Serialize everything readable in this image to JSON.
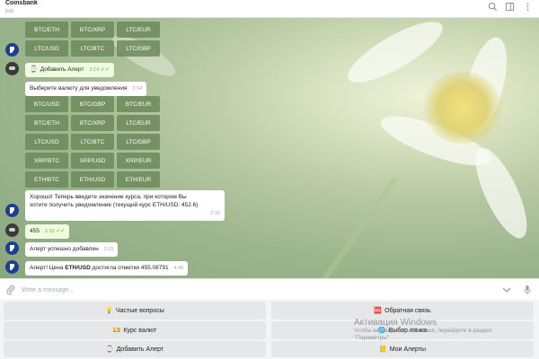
{
  "header": {
    "title": "Coinsbank",
    "subtitle": "bot"
  },
  "keyboard_top": [
    [
      "BTC/ETH",
      "BTC/XRP",
      "LTC/EUR"
    ],
    [
      "LTC/USD",
      "LTC/BTC",
      "LTC/GBP"
    ]
  ],
  "msg_add_alert": {
    "text": "Добавить Алерт",
    "time": "2:14"
  },
  "msg_choose": {
    "text": "Выберите валюту для уведомления",
    "time": "2:14"
  },
  "keyboard_main": [
    [
      "BTC/USD",
      "BTC/GBP",
      "BTC/EUR"
    ],
    [
      "BTC/ETH",
      "BTC/XRP",
      "LTC/EUR"
    ],
    [
      "LTC/USD",
      "LTC/BTC",
      "LTC/GBP"
    ],
    [
      "XRP/BTC",
      "XRP/USD",
      "XRP/EUR"
    ],
    [
      "ETH/BTC",
      "ETH/USD",
      "ETH/EUR"
    ]
  ],
  "msg_enter": {
    "line1": "Хорошо! Теперь введите значение курса, при котором Вы",
    "line2": "хотите получить уведомление (текущий курс ETH/USD: 452.6)",
    "time": "2:15"
  },
  "msg_value": {
    "text": "455",
    "time": "2:15"
  },
  "msg_added": {
    "text": "Алерт успешно добавлен",
    "time": "2:15"
  },
  "msg_triggered": {
    "prefix": "Алерт! Цена ",
    "pair": "ETH/USD",
    "suffix": " достигла отметки 455.08791",
    "time": "4:45"
  },
  "composer": {
    "placeholder": "Write a message..."
  },
  "reply_keyboard": {
    "faq": "Частые вопросы",
    "feedback": "Обратная связь",
    "rates": "Курс валют",
    "language": "Выбор языка",
    "add_alert": "Добавить Алерт",
    "my_alerts": "Мои Алерты"
  },
  "watermark": {
    "title": "Активация Windows",
    "line1": "Чтобы активировать Windows, перейдите в раздел",
    "line2": "\"Параметры\"."
  },
  "colors": {
    "bot_avatar": "#1d3e91",
    "inline_button": "#6c895a",
    "outgoing_bubble": "#effdde",
    "read_check": "#4fae4e"
  },
  "icons": {
    "header": [
      "search-icon",
      "sidebar-icon",
      "more-icon"
    ],
    "composer": [
      "attach-icon",
      "chevron-down-icon",
      "microphone-icon"
    ]
  }
}
